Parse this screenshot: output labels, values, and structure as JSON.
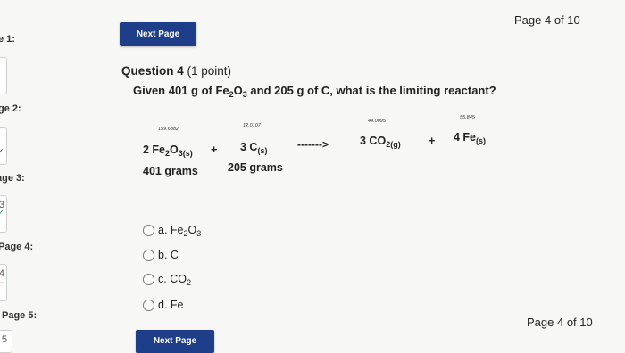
{
  "sidebar": {
    "labels": [
      "e 1:",
      "ge 2:",
      "age 3:",
      "Page 4:",
      "Page 5:"
    ],
    "boxes": [
      {
        "num": "",
        "mark": ""
      },
      {
        "num": "",
        "mark": "✓"
      },
      {
        "num": "3",
        "mark": "✓"
      },
      {
        "num": "4",
        "mark": "--"
      },
      {
        "num": "5",
        "mark": ""
      }
    ]
  },
  "nav": {
    "next_label": "Next Page",
    "page_indicator": "Page 4 of 10"
  },
  "question": {
    "title_bold": "Question 4",
    "points": " (1 point)",
    "text_pre": "Given 401 g of Fe",
    "text_sub1": "2",
    "text_mid1": "O",
    "text_sub2": "3",
    "text_mid2": " and 205 g of C, what is the limiting reactant?"
  },
  "equation": {
    "molar_masses": [
      "159.6882",
      "12.0107",
      "44.0095",
      "55.845"
    ],
    "r1_coef": "2 Fe",
    "r1_sub1": "2",
    "r1_o": "O",
    "r1_sub2": "3(s)",
    "plus1": "+",
    "r2_coef": "3 C",
    "r2_sub": "(s)",
    "arrow": "------->",
    "p1_coef": "3 CO",
    "p1_sub": "2(g)",
    "plus2": "+",
    "p2_coef": "4 Fe",
    "p2_sub": "(s)",
    "mass1": "401 grams",
    "mass2": "205 grams"
  },
  "options": [
    {
      "letter": "a. Fe",
      "sub1": "2",
      "mid": "O",
      "sub2": "3"
    },
    {
      "letter": "b. C"
    },
    {
      "letter": "c. CO",
      "sub1": "2"
    },
    {
      "letter": "d. Fe"
    }
  ]
}
